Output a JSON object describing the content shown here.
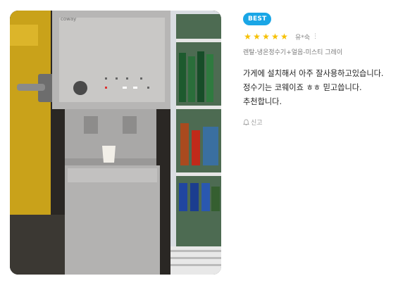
{
  "photo": {
    "alt_icon": "review-photo-icon",
    "brand_label": "coway"
  },
  "review": {
    "badge": "BEST",
    "rating": 5,
    "rating_max": 5,
    "star_color": "#f6c000",
    "user": "유*숙",
    "more_icon": "kebab-menu-icon",
    "option": "렌탈-냉온정수기+얼음-미스티 그레이",
    "lines": [
      "가게에 설치해서 아주 잘사용하고있습니다.",
      "정수기는 코웨이죠 ㅎㅎ 믿고씁니다.",
      "추천합니다."
    ],
    "report_label": "신고"
  },
  "colors": {
    "badge": "#1aa6e6",
    "text": "#222222",
    "muted": "#888888"
  }
}
